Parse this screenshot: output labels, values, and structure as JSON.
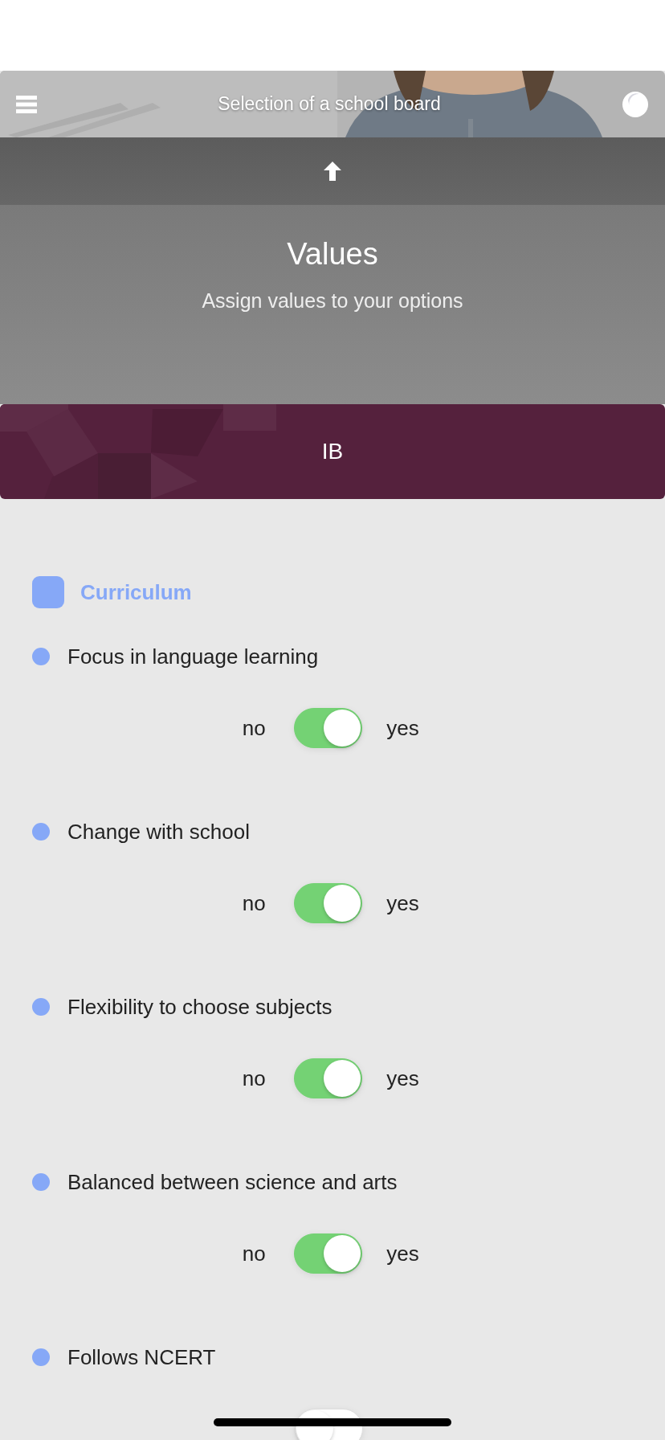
{
  "header": {
    "title": "Selection of a school board"
  },
  "section": {
    "title": "Values",
    "subtitle": "Assign values to your options"
  },
  "option": {
    "name": "IB"
  },
  "category": {
    "name": "Curriculum"
  },
  "criteria": [
    {
      "label": "Focus in language learning",
      "no": "no",
      "yes": "yes",
      "on": true
    },
    {
      "label": "Change with school",
      "no": "no",
      "yes": "yes",
      "on": true
    },
    {
      "label": "Flexibility to choose subjects",
      "no": "no",
      "yes": "yes",
      "on": true
    },
    {
      "label": "Balanced between science and arts",
      "no": "no",
      "yes": "yes",
      "on": true
    },
    {
      "label": "Follows NCERT",
      "on": false
    }
  ]
}
